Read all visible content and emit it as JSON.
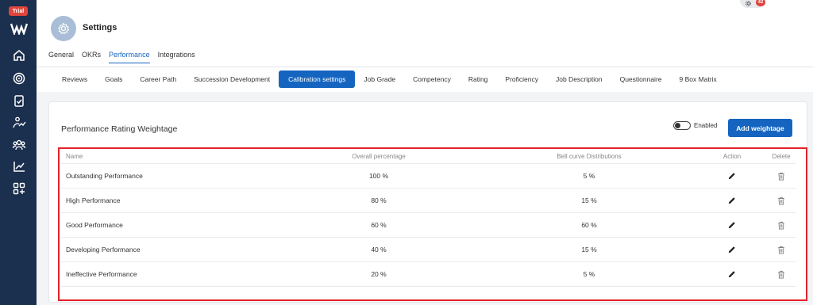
{
  "sidebar": {
    "trial_label": "Trial",
    "icons": [
      "logo-icon",
      "home-icon",
      "target-icon",
      "clipboard-icon",
      "performance-icon",
      "team-icon",
      "analytics-icon",
      "apps-add-icon"
    ]
  },
  "header": {
    "title": "Settings",
    "notification_count": "42",
    "tabs": [
      {
        "label": "General",
        "active": false
      },
      {
        "label": "OKRs",
        "active": false
      },
      {
        "label": "Performance",
        "active": true
      },
      {
        "label": "Integrations",
        "active": false
      }
    ]
  },
  "subnav": {
    "items": [
      {
        "label": "Reviews"
      },
      {
        "label": "Goals"
      },
      {
        "label": "Career Path"
      },
      {
        "label": "Succession Development"
      },
      {
        "label": "Calibration settings",
        "active": true
      },
      {
        "label": "Job Grade"
      },
      {
        "label": "Competency"
      },
      {
        "label": "Rating"
      },
      {
        "label": "Proficiency"
      },
      {
        "label": "Job Description"
      },
      {
        "label": "Questionnaire"
      },
      {
        "label": "9 Box Matrix"
      }
    ]
  },
  "card": {
    "title": "Performance Rating Weightage",
    "toggle_label": "Enabled",
    "add_button_label": "Add weightage"
  },
  "table": {
    "headers": {
      "name": "Name",
      "overall": "Overall percentage",
      "bell": "Bell curve Distributions",
      "action": "Action",
      "delete": "Delete"
    },
    "rows": [
      {
        "name": "Outstanding Performance",
        "overall": "100 %",
        "bell": "5 %"
      },
      {
        "name": "High Performance",
        "overall": "80 %",
        "bell": "15 %"
      },
      {
        "name": "Good Performance",
        "overall": "60 %",
        "bell": "60 %"
      },
      {
        "name": "Developing Performance",
        "overall": "40 %",
        "bell": "15 %"
      },
      {
        "name": "Ineffective Performance",
        "overall": "20 %",
        "bell": "5 %"
      }
    ]
  },
  "colors": {
    "sidebar": "#1b2f4e",
    "accent": "#1565c0",
    "highlight": "#e3222b",
    "badge": "#e0443a"
  }
}
